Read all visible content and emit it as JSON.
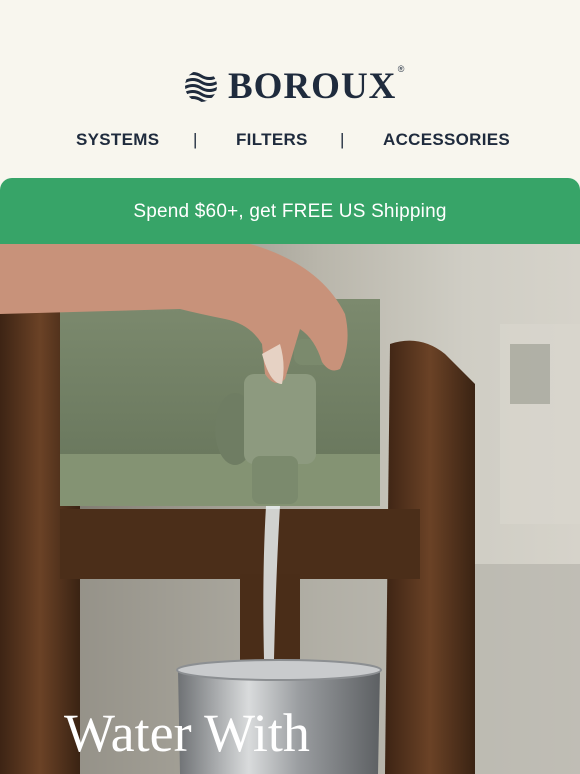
{
  "brand": {
    "name": "BOROUX",
    "registered": "®",
    "logo_icon": "wave-sphere-icon"
  },
  "nav": {
    "items": [
      {
        "label": "SYSTEMS"
      },
      {
        "label": "FILTERS"
      },
      {
        "label": "ACCESSORIES"
      }
    ],
    "separator": "|"
  },
  "promo_banner": {
    "text": "Spend $60+, get FREE US Shipping",
    "color": "#37a468"
  },
  "hero": {
    "image_subject": "water-dispenser-photo",
    "headline": "Water With"
  },
  "colors": {
    "background": "#f8f6ee",
    "text": "#1f2b3d",
    "accent": "#37a468"
  }
}
